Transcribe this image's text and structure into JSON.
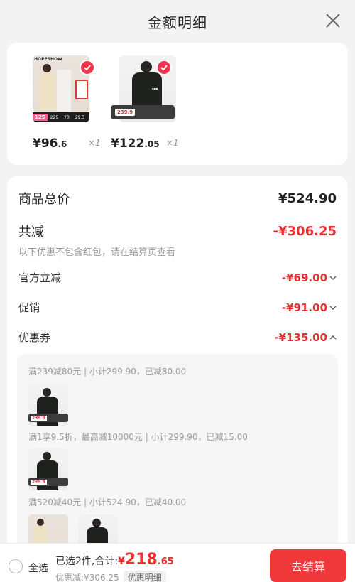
{
  "header": {
    "title": "金额明细"
  },
  "products": [
    {
      "brand_text": "HOPESHOW",
      "badge_price": "125",
      "stats": [
        "225",
        "70",
        "29.3"
      ],
      "price_int": "¥96",
      "price_dec": ".6",
      "qty": "×1"
    },
    {
      "badge_price": "239.9",
      "price_int": "¥122",
      "price_dec": ".05",
      "qty": "×1"
    }
  ],
  "details": {
    "total_label": "商品总价",
    "total_value": "¥524.90",
    "reduce_label": "共减",
    "reduce_value": "-¥306.25",
    "note": "以下优惠不包含红包，请在结算页查看",
    "official_label": "官方立减",
    "official_value": "-¥69.00",
    "promo_label": "促销",
    "promo_value": "-¥91.00",
    "coupon_label": "优惠券",
    "coupon_value": "-¥135.00"
  },
  "coupons": [
    {
      "rule": "满239减80元 | 小计299.90，已减80.00",
      "thumb_price": "239.9"
    },
    {
      "rule": "满1享9.5折，最高减10000元 | 小计299.90，已减15.00",
      "thumb_price": "239.9"
    },
    {
      "rule": "满520减40元 | 小计524.90，已减40.00"
    }
  ],
  "bottom": {
    "select_all": "全选",
    "selected_text": "已选2件,合计:",
    "currency": "¥",
    "total_int": "218",
    "total_dec": ".65",
    "discount_text": "优惠减:¥306.25",
    "detail_tag": "优惠明细",
    "checkout": "去结算"
  },
  "colors": {
    "accent_red": "#e8312f",
    "button_red": "#f0393a"
  }
}
